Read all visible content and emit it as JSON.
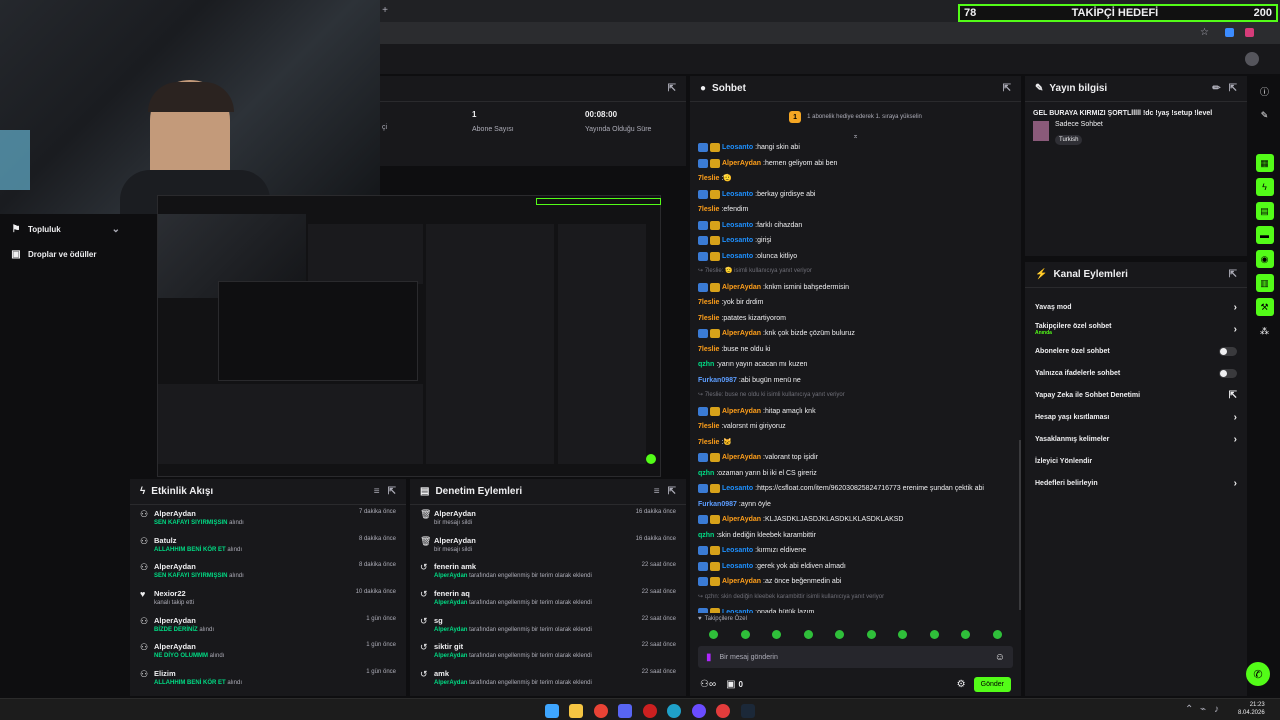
{
  "overlay": {
    "follower_count": "78",
    "goal_title": "TAKİPÇİ HEDEFİ",
    "goal_target": "200"
  },
  "stats": {
    "subscriber_value": "1",
    "subscriber_label": "Abone Sayısı",
    "uptime_value": "00:08:00",
    "uptime_label": "Yayında Olduğu Süre",
    "partial_label": "çi"
  },
  "sidebar": {
    "community": "Topluluk",
    "drops": "Droplar ve ödüller"
  },
  "chat": {
    "title": "Sohbet",
    "hype_text": "1 abonelik hediye ederek 1. sıraya yükselin",
    "pinned_label": "Takipçilere Özel",
    "input_placeholder": "Bir mesaj gönderin",
    "points": "0",
    "send_label": "Gönder",
    "messages": [
      {
        "user": "Leosanto",
        "color": "#1e90ff",
        "text": "hangi skin abi",
        "badges": 2
      },
      {
        "user": "AlperAydan",
        "color": "#ff9f1a",
        "text": "hemen geliyom abi ben",
        "badges": 2
      },
      {
        "user": "7leslie",
        "color": "#ff9f1a",
        "text": "🫡",
        "badges": 0
      },
      {
        "user": "Leosanto",
        "color": "#1e90ff",
        "text": "berkay girdisye abi",
        "badges": 2
      },
      {
        "user": "7leslie",
        "color": "#ff9f1a",
        "text": "efendim",
        "badges": 0
      },
      {
        "user": "Leosanto",
        "color": "#1e90ff",
        "text": "farklı cihazdan",
        "badges": 2
      },
      {
        "user": "Leosanto",
        "color": "#1e90ff",
        "text": "girişi",
        "badges": 2
      },
      {
        "user": "Leosanto",
        "color": "#1e90ff",
        "text": "olunca kitliyo",
        "badges": 2
      },
      {
        "user": "",
        "color": "#adadb8",
        "text": "↪ 7leslie: 🫡 isimli kullanıcıya yanıt veriyor",
        "badges": 0,
        "reply": true
      },
      {
        "user": "AlperAydan",
        "color": "#ff9f1a",
        "text": "knkm ismini bahşedermisin",
        "badges": 2
      },
      {
        "user": "7leslie",
        "color": "#ff9f1a",
        "text": "yok bir drdim",
        "badges": 0
      },
      {
        "user": "7leslie",
        "color": "#ff9f1a",
        "text": "patates kizartiyorom",
        "badges": 0
      },
      {
        "user": "AlperAydan",
        "color": "#ff9f1a",
        "text": "knk çok bizde çözüm buluruz",
        "badges": 2
      },
      {
        "user": "7leslie",
        "color": "#ff9f1a",
        "text": "buse ne oldu ki",
        "badges": 0
      },
      {
        "user": "qzhn",
        "color": "#00db84",
        "text": "yarın yayın acacan mı kuzen",
        "badges": 0
      },
      {
        "user": "Furkan0987",
        "color": "#5c9dff",
        "text": "abi bugün menü ne",
        "badges": 0
      },
      {
        "user": "",
        "color": "#adadb8",
        "text": "↪ 7leslie: buse ne oldu ki isimli kullanıcıya yanıt veriyor",
        "badges": 0,
        "reply": true
      },
      {
        "user": "AlperAydan",
        "color": "#ff9f1a",
        "text": "hitap amaçlı knk",
        "badges": 2
      },
      {
        "user": "7leslie",
        "color": "#ff9f1a",
        "text": "valorsnt mi giriyoruz",
        "badges": 0
      },
      {
        "user": "7leslie",
        "color": "#ff9f1a",
        "text": "🐱",
        "badges": 0
      },
      {
        "user": "AlperAydan",
        "color": "#ff9f1a",
        "text": "valorant top işidir",
        "badges": 2
      },
      {
        "user": "qzhn",
        "color": "#00db84",
        "text": "ozaman yarın bi iki el CS gireriz",
        "badges": 0
      },
      {
        "user": "Leosanto",
        "color": "#1e90ff",
        "text": "https://csfloat.com/item/962030825824716773 erenime şundan çektik abi",
        "badges": 2
      },
      {
        "user": "Furkan0987",
        "color": "#5c9dff",
        "text": "aynn öyle",
        "badges": 0
      },
      {
        "user": "AlperAydan",
        "color": "#ff9f1a",
        "text": "KLJASDKLJASDJKLASDKLKLASDKLAKSD",
        "badges": 2
      },
      {
        "user": "qzhn",
        "color": "#00db84",
        "text": "skin dediğin kleebek karambittir",
        "badges": 0
      },
      {
        "user": "Leosanto",
        "color": "#1e90ff",
        "text": "kırmızı eldivene",
        "badges": 2
      },
      {
        "user": "Leosanto",
        "color": "#1e90ff",
        "text": "gerek yok abi eldiven almadı",
        "badges": 2
      },
      {
        "user": "AlperAydan",
        "color": "#ff9f1a",
        "text": "az önce beğenmedin abi",
        "badges": 2
      },
      {
        "user": "",
        "color": "#adadb8",
        "text": "↪ qzhn: skin dediğin kleebek karambittir isimli kullanıcıya yanıt veriyor",
        "badges": 0,
        "reply": true
      },
      {
        "user": "Leosanto",
        "color": "#1e90ff",
        "text": "onada bütük lazım",
        "badges": 2
      },
      {
        "user": "BotRix",
        "color": "#00db84",
        "text": "Yeni gelenler hoş geldiniz. Eğer yayın hoşunuza giderse takip etmeyi unutmayın :)",
        "badges": 2
      }
    ]
  },
  "stream_info": {
    "title": "Yayın bilgisi",
    "stream_title": "GEL BURAYA KIRMIZI ŞORTLlllll !dc !yaş !setup !level",
    "chat_mode": "Sadece Sohbet",
    "language": "Turkish"
  },
  "channel_actions": {
    "title": "Kanal Eylemleri",
    "items": [
      {
        "label": "Yavaş mod",
        "type": "arrow"
      },
      {
        "label": "Takipçilere özel sohbet",
        "sub": "Anında",
        "type": "arrow"
      },
      {
        "label": "Abonelere özel sohbet",
        "type": "toggle"
      },
      {
        "label": "Yalnızca ifadelerle sohbet",
        "type": "toggle"
      },
      {
        "label": "Yapay Zeka ile Sohbet Denetimi",
        "type": "external"
      },
      {
        "label": "Hesap yaşı kısıtlaması",
        "type": "arrow"
      },
      {
        "label": "Yasaklanmış kelimeler",
        "type": "arrow"
      },
      {
        "label": "İzleyici Yönlendir",
        "type": "none"
      },
      {
        "label": "Hedefleri belirleyin",
        "type": "arrow"
      }
    ]
  },
  "activity": {
    "title": "Etkinlik Akışı",
    "items": [
      {
        "user": "AlperAydan",
        "desc": "SEN KAFAYI SIYIRMIŞSIN",
        "suffix": " alındı",
        "time": "7 dakika önce",
        "icon": "reward"
      },
      {
        "user": "Batulz",
        "desc": "ALLAHHIM BENİ KÖR ET",
        "suffix": " alındı",
        "time": "8 dakika önce",
        "icon": "reward"
      },
      {
        "user": "AlperAydan",
        "desc": "SEN KAFAYI SIYIRMIŞSIN",
        "suffix": " alındı",
        "time": "8 dakika önce",
        "icon": "reward"
      },
      {
        "user": "Nexior22",
        "desc": "",
        "suffix": "kanalı takip etti",
        "time": "10 dakika önce",
        "icon": "heart"
      },
      {
        "user": "AlperAydan",
        "desc": "BİZDE DERİNİZ",
        "suffix": " alındı",
        "time": "1 gün önce",
        "icon": "reward"
      },
      {
        "user": "AlperAydan",
        "desc": "NE DİYO OLUMMM",
        "suffix": " alındı",
        "time": "1 gün önce",
        "icon": "reward"
      },
      {
        "user": "Elizim",
        "desc": "ALLAHHIM BENİ KÖR ET",
        "suffix": " alındı",
        "time": "1 gün önce",
        "icon": "reward"
      }
    ]
  },
  "moderation": {
    "title": "Denetim Eylemleri",
    "items": [
      {
        "title": "AlperAydan",
        "actor": "",
        "desc": "bir mesajı sildi",
        "time": "16 dakika önce",
        "icon": "trash"
      },
      {
        "title": "AlperAydan",
        "actor": "",
        "desc": "bir mesajı sildi",
        "time": "16 dakika önce",
        "icon": "trash"
      },
      {
        "title": "fenerin amk",
        "actor": "AlperAydan",
        "desc": " tarafından engellenmiş bir terim olarak eklendi",
        "time": "22 saat önce",
        "icon": "undo"
      },
      {
        "title": "fenerin aq",
        "actor": "AlperAydan",
        "desc": " tarafından engellenmiş bir terim olarak eklendi",
        "time": "22 saat önce",
        "icon": "undo"
      },
      {
        "title": "sg",
        "actor": "AlperAydan",
        "desc": " tarafından engellenmiş bir terim olarak eklendi",
        "time": "22 saat önce",
        "icon": "undo"
      },
      {
        "title": "siktir git",
        "actor": "AlperAydan",
        "desc": " tarafından engellenmiş bir terim olarak eklendi",
        "time": "22 saat önce",
        "icon": "undo"
      },
      {
        "title": "amk",
        "actor": "AlperAydan",
        "desc": " tarafından engellenmiş bir terim olarak eklendi",
        "time": "22 saat önce",
        "icon": "undo"
      }
    ]
  },
  "taskbar": {
    "time": "21:23",
    "date": "8.04.2026"
  },
  "colors": {
    "accent": "#53fc18",
    "panel": "#18181b",
    "green_text": "#00db84"
  }
}
